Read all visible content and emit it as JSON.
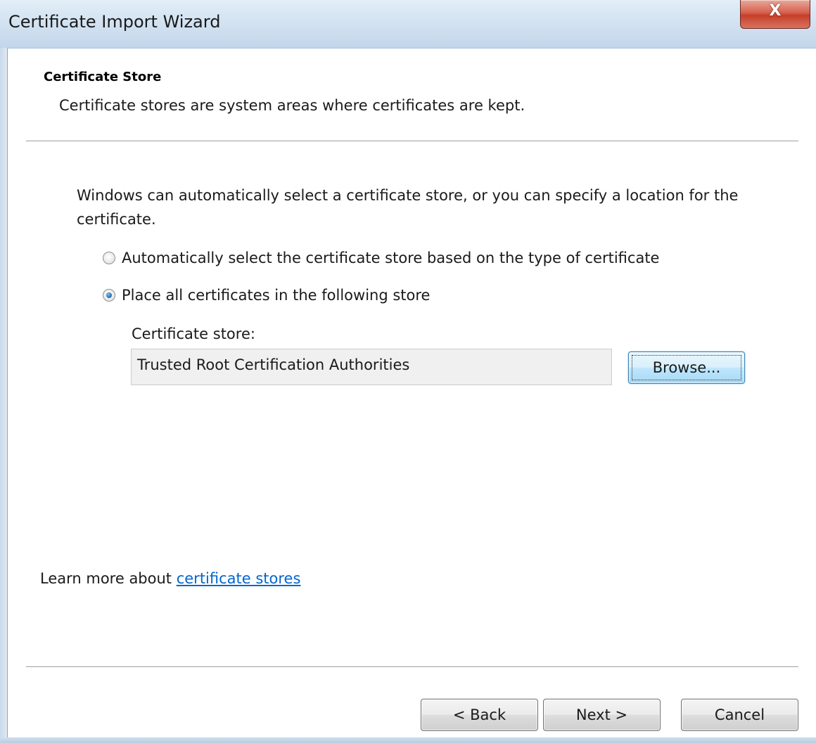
{
  "window": {
    "title": "Certificate Import Wizard",
    "close_glyph": "X"
  },
  "header": {
    "title": "Certificate Store",
    "description": "Certificate stores are system areas where certificates are kept."
  },
  "body": {
    "intro": "Windows can automatically select a certificate store, or you can specify a location for the certificate.",
    "options": [
      {
        "label": "Automatically select the certificate store based on the type of certificate",
        "selected": false
      },
      {
        "label": "Place all certificates in the following store",
        "selected": true
      }
    ],
    "store_label": "Certificate store:",
    "store_value": "Trusted Root Certification Authorities",
    "browse_label": "Browse..."
  },
  "learn_more": {
    "prefix": "Learn more about ",
    "link_text": "certificate stores"
  },
  "footer": {
    "back_label": "< Back",
    "next_label": "Next >",
    "cancel_label": "Cancel"
  },
  "colors": {
    "link": "#0066cc",
    "close_button": "#c53f2a",
    "radio_selected": "#1f67b0"
  }
}
